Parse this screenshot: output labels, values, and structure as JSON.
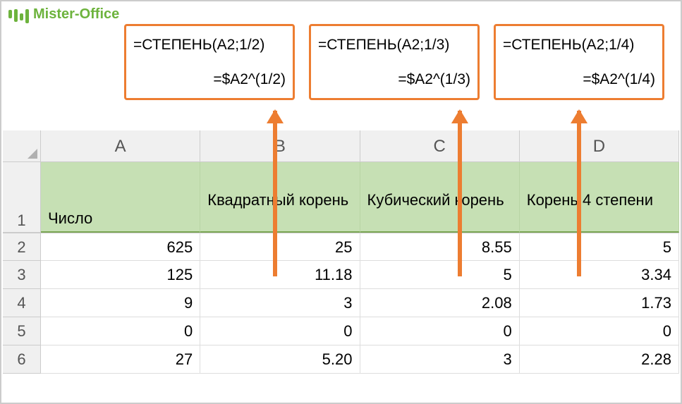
{
  "logo": {
    "text": "Mister-Office"
  },
  "formulas": {
    "box1": {
      "line1": "=СТЕПЕНЬ(A2;1/2)",
      "line2": "=$A2^(1/2)"
    },
    "box2": {
      "line1": "=СТЕПЕНЬ(A2;1/3)",
      "line2": "=$A2^(1/3)"
    },
    "box3": {
      "line1": "=СТЕПЕНЬ(A2;1/4)",
      "line2": "=$A2^(1/4)"
    }
  },
  "columns": [
    "A",
    "B",
    "C",
    "D"
  ],
  "headers": {
    "A": "Число",
    "B": "Квадратный корень",
    "C": "Кубический корень",
    "D": "Корень 4 степени"
  },
  "rows": [
    {
      "num": "2",
      "A": "625",
      "B": "25",
      "C": "8.55",
      "D": "5"
    },
    {
      "num": "3",
      "A": "125",
      "B": "11.18",
      "C": "5",
      "D": "3.34"
    },
    {
      "num": "4",
      "A": "9",
      "B": "3",
      "C": "2.08",
      "D": "1.73"
    },
    {
      "num": "5",
      "A": "0",
      "B": "0",
      "C": "0",
      "D": "0"
    },
    {
      "num": "6",
      "A": "27",
      "B": "5.20",
      "C": "3",
      "D": "2.28"
    }
  ],
  "header_row_num": "1"
}
